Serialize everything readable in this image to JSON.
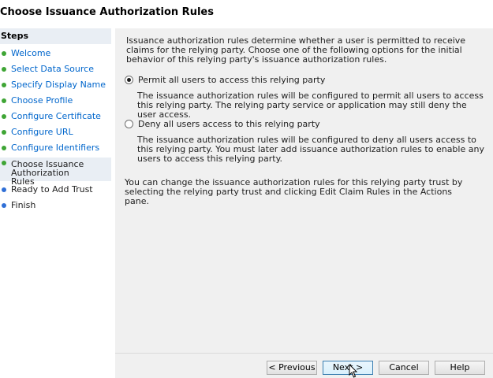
{
  "page": {
    "title": "Choose Issuance Authorization Rules"
  },
  "sidebar": {
    "header": "Steps",
    "steps": [
      {
        "label": "Welcome",
        "state": "done"
      },
      {
        "label": "Select Data Source",
        "state": "done"
      },
      {
        "label": "Specify Display Name",
        "state": "done"
      },
      {
        "label": "Choose Profile",
        "state": "done"
      },
      {
        "label": "Configure Certificate",
        "state": "done"
      },
      {
        "label": "Configure URL",
        "state": "done"
      },
      {
        "label": "Configure Identifiers",
        "state": "done"
      },
      {
        "label": "Choose Issuance Authorization Rules",
        "state": "current"
      },
      {
        "label": "Ready to Add Trust",
        "state": "pending"
      },
      {
        "label": "Finish",
        "state": "pending"
      }
    ]
  },
  "main": {
    "intro": "Issuance authorization rules determine whether a user is permitted to receive claims for the relying party. Choose one of the following options for the initial behavior of this relying party's issuance authorization rules.",
    "options": [
      {
        "label": "Permit all users to access this relying party",
        "description": "The issuance authorization rules will be configured to permit all users to access this relying party. The relying party service or application may still deny the user access.",
        "selected": true
      },
      {
        "label": "Deny all users access to this relying party",
        "description": "The issuance authorization rules will be configured to deny all users access to this relying party. You must later add issuance authorization rules to enable any users to access this relying party.",
        "selected": false
      }
    ],
    "note": "You can change the issuance authorization rules for this relying party trust by selecting the relying party trust and clicking Edit Claim Rules in the Actions pane."
  },
  "buttons": {
    "previous": "< Previous",
    "next": "Next >",
    "cancel": "Cancel",
    "help": "Help"
  },
  "colors": {
    "link": "#0066cc",
    "done_bullet": "#3fa535",
    "pending_bullet": "#2f6fd6",
    "panel_bg": "#f0f0f0",
    "highlight_bg": "#e9eef4"
  }
}
